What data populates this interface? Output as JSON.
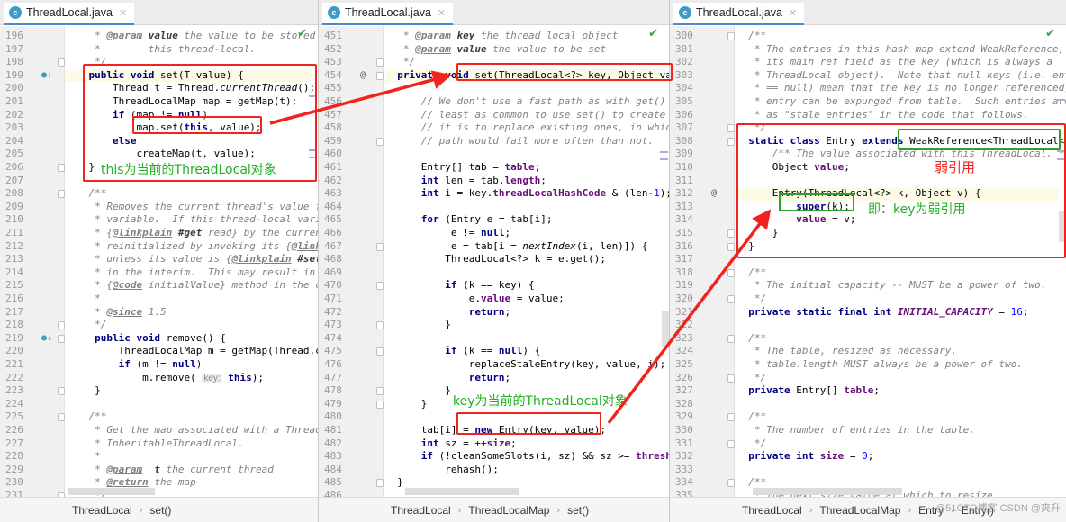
{
  "panes": [
    {
      "tab_label": "ThreadLocal.java",
      "tab_icon": "c",
      "breadcrumb": [
        "ThreadLocal",
        "set()"
      ],
      "lines": [
        {
          "n": "196",
          "html": "     <span class=\"cm\">* </span><span class=\"tag\">@param</span><span class=\"jdb\"> value</span><span class=\"cm\"> the value to be stored</span>"
        },
        {
          "n": "197",
          "html": "     <span class=\"cm\">*        this thread-local.</span>"
        },
        {
          "n": "198",
          "html": "     <span class=\"cm\">*/</span>"
        },
        {
          "n": "199",
          "html": "    <span class=\"kw\">public void</span> set(T value) {",
          "hl": true
        },
        {
          "n": "200",
          "html": "        Thread t = Thread.<span class=\"sit\">currentThread</span>();"
        },
        {
          "n": "201",
          "html": "        ThreadLocalMap map = getMap(t);"
        },
        {
          "n": "202",
          "html": "        <span class=\"kw\">if</span> (map != <span class=\"kw\">null</span>)"
        },
        {
          "n": "203",
          "html": "            map.set(<span class=\"kw\">this</span>, value);"
        },
        {
          "n": "204",
          "html": "        <span class=\"kw\">else</span>"
        },
        {
          "n": "205",
          "html": "            createMap(t, value);"
        },
        {
          "n": "206",
          "html": "    }"
        },
        {
          "n": "207",
          "html": ""
        },
        {
          "n": "208",
          "html": "    <span class=\"cm\">/**</span>"
        },
        {
          "n": "209",
          "html": "     <span class=\"cm\">* Removes the current thread's value for this thread-local</span>"
        },
        {
          "n": "210",
          "html": "     <span class=\"cm\">* variable.  If this thread-local variable is subsequently</span>"
        },
        {
          "n": "211",
          "html": "     <span class=\"cm\">* {</span><span class=\"tag\">@linkplain</span><span class=\"jdb\"> #get</span><span class=\"cm\"> read} by the current thread, its value will be</span>"
        },
        {
          "n": "212",
          "html": "     <span class=\"cm\">* reinitialized by invoking its {</span><span class=\"tag\">@link</span><span class=\"cm\"> #initialValue}</span>"
        },
        {
          "n": "213",
          "html": "     <span class=\"cm\">* unless its value is {</span><span class=\"tag\">@linkplain</span><span class=\"jdb\"> #set</span><span class=\"cm\"> set} by the</span>"
        },
        {
          "n": "214",
          "html": "     <span class=\"cm\">* in the interim.  This may result in multiple</span>"
        },
        {
          "n": "215",
          "html": "     <span class=\"cm\">* {</span><span class=\"tag\">@code</span><span class=\"cm\"> initialValue} method in the current thread.</span>"
        },
        {
          "n": "216",
          "html": "     <span class=\"cm\">*</span>"
        },
        {
          "n": "217",
          "html": "     <span class=\"cm\">* </span><span class=\"tag\">@since</span><span class=\"cm\"> 1.5</span>"
        },
        {
          "n": "218",
          "html": "     <span class=\"cm\">*/</span>"
        },
        {
          "n": "219",
          "html": "     <span class=\"kw\">public void</span> remove() {"
        },
        {
          "n": "220",
          "html": "         ThreadLocalMap m = getMap(Thread.currentThread());"
        },
        {
          "n": "221",
          "html": "         <span class=\"kw\">if</span> (m != <span class=\"kw\">null</span>)"
        },
        {
          "n": "222",
          "html": "             m.remove( <span class=\"hint\">key:</span> <span class=\"kw\">this</span>);"
        },
        {
          "n": "223",
          "html": "     }"
        },
        {
          "n": "224",
          "html": ""
        },
        {
          "n": "225",
          "html": "    <span class=\"cm\">/**</span>"
        },
        {
          "n": "226",
          "html": "     <span class=\"cm\">* Get the map associated with a ThreadLocal. Overridden in</span>"
        },
        {
          "n": "227",
          "html": "     <span class=\"cm\">* InheritableThreadLocal.</span>"
        },
        {
          "n": "228",
          "html": "     <span class=\"cm\">*</span>"
        },
        {
          "n": "229",
          "html": "     <span class=\"cm\">* </span><span class=\"tag\">@param</span><span class=\"jdb\">  t</span><span class=\"cm\"> the current thread</span>"
        },
        {
          "n": "230",
          "html": "     <span class=\"cm\">* </span><span class=\"tag\">@return</span><span class=\"cm\"> the map</span>"
        },
        {
          "n": "231",
          "html": "     <span class=\"cm\">*/</span>"
        }
      ],
      "annotation": "this为当前的ThreadLocal对象"
    },
    {
      "tab_label": "ThreadLocal.java",
      "tab_icon": "c",
      "breadcrumb": [
        "ThreadLocal",
        "ThreadLocalMap",
        "set()"
      ],
      "lines": [
        {
          "n": "451",
          "html": "   <span class=\"cm\">* </span><span class=\"tag\">@param</span><span class=\"jdb\"> key</span><span class=\"cm\"> the thread local object</span>"
        },
        {
          "n": "452",
          "html": "   <span class=\"cm\">* </span><span class=\"tag\">@param</span><span class=\"jdb\"> value</span><span class=\"cm\"> the value to be set</span>"
        },
        {
          "n": "453",
          "html": "   <span class=\"cm\">*/</span>"
        },
        {
          "n": "454",
          "html": "  <span class=\"kw\">private void</span> set(ThreadLocal&lt;?&gt; key, Object value) {",
          "hl": true
        },
        {
          "n": "455",
          "html": ""
        },
        {
          "n": "456",
          "html": "      <span class=\"cm\">// We don't use a fast path as with get() because it is at</span>"
        },
        {
          "n": "457",
          "html": "      <span class=\"cm\">// least as common to use set() to create new entries as</span>"
        },
        {
          "n": "458",
          "html": "      <span class=\"cm\">// it is to replace existing ones, in which case, a fast</span>"
        },
        {
          "n": "459",
          "html": "      <span class=\"cm\">// path would fail more often than not.</span>"
        },
        {
          "n": "460",
          "html": ""
        },
        {
          "n": "461",
          "html": "      Entry[] tab = <span class=\"fld\">table</span>;"
        },
        {
          "n": "462",
          "html": "      <span class=\"kw\">int</span> len = tab.<span class=\"fld\">length</span>;"
        },
        {
          "n": "463",
          "html": "      <span class=\"kw\">int</span> i = key.<span class=\"fld\">threadLocalHashCode</span> &amp; (len-<span class=\"num\">1</span>);"
        },
        {
          "n": "464",
          "html": ""
        },
        {
          "n": "465",
          "html": "      <span class=\"kw\">for</span> (Entry e = tab[i];"
        },
        {
          "n": "466",
          "html": "           e != <span class=\"kw\">null</span>;"
        },
        {
          "n": "467",
          "html": "           e = tab[i = <span class=\"sit\">nextIndex</span>(i, len)]) {"
        },
        {
          "n": "468",
          "html": "          ThreadLocal&lt;?&gt; k = e.get();"
        },
        {
          "n": "469",
          "html": ""
        },
        {
          "n": "470",
          "html": "          <span class=\"kw\">if</span> (k == key) {"
        },
        {
          "n": "471",
          "html": "              e.<span class=\"fld\">value</span> = value;"
        },
        {
          "n": "472",
          "html": "              <span class=\"kw\">return</span>;"
        },
        {
          "n": "473",
          "html": "          }"
        },
        {
          "n": "474",
          "html": ""
        },
        {
          "n": "475",
          "html": "          <span class=\"kw\">if</span> (k == <span class=\"kw\">null</span>) {"
        },
        {
          "n": "476",
          "html": "              replaceStaleEntry(key, value, i);"
        },
        {
          "n": "477",
          "html": "              <span class=\"kw\">return</span>;"
        },
        {
          "n": "478",
          "html": "          }"
        },
        {
          "n": "479",
          "html": "      }"
        },
        {
          "n": "480",
          "html": ""
        },
        {
          "n": "481",
          "html": "      tab[i] = <span class=\"kw\">new</span> Entry(key, value);"
        },
        {
          "n": "482",
          "html": "      <span class=\"kw\">int</span> sz = ++<span class=\"fld\">size</span>;"
        },
        {
          "n": "483",
          "html": "      <span class=\"kw\">if</span> (!cleanSomeSlots(i, sz) &amp;&amp; sz &gt;= <span class=\"fld\">threshold</span>)"
        },
        {
          "n": "484",
          "html": "          rehash();"
        },
        {
          "n": "485",
          "html": "  }"
        },
        {
          "n": "486",
          "html": ""
        }
      ],
      "annotation": "key为当前的ThreadLocal对象"
    },
    {
      "tab_label": "ThreadLocal.java",
      "tab_icon": "c",
      "breadcrumb": [
        "ThreadLocal",
        "ThreadLocalMap",
        "Entry",
        "Entry()"
      ],
      "lines": [
        {
          "n": "300",
          "html": "  <span class=\"cm\">/**</span>"
        },
        {
          "n": "301",
          "html": "   <span class=\"cm\">* The entries in this hash map extend WeakReference, using</span>"
        },
        {
          "n": "302",
          "html": "   <span class=\"cm\">* its main ref field as the key (which is always a</span>"
        },
        {
          "n": "303",
          "html": "   <span class=\"cm\">* ThreadLocal object).  Note that null keys (i.e. entry.get()</span>"
        },
        {
          "n": "304",
          "html": "   <span class=\"cm\">* == null) mean that the key is no longer referenced, so the</span>"
        },
        {
          "n": "305",
          "html": "   <span class=\"cm\">* entry can be expunged from table.  Such entries are referred to</span>"
        },
        {
          "n": "306",
          "html": "   <span class=\"cm\">* as \"stale entries\" in the code that follows.</span>"
        },
        {
          "n": "307",
          "html": "   <span class=\"cm\">*/</span>"
        },
        {
          "n": "308",
          "html": "  <span class=\"kw\">static class</span> Entry <span class=\"kw\">extends</span> WeakReference&lt;ThreadLocal&lt;?&gt;&gt; {"
        },
        {
          "n": "309",
          "html": "      <span class=\"cm\">/** The value associated with this ThreadLocal. */</span>"
        },
        {
          "n": "310",
          "html": "      Object <span class=\"fld\">value</span>;"
        },
        {
          "n": "311",
          "html": ""
        },
        {
          "n": "312",
          "html": "      Entry(ThreadLocal&lt;?&gt; k, Object v) {",
          "hl": true
        },
        {
          "n": "313",
          "html": "          <span class=\"kw\">super</span>(k);"
        },
        {
          "n": "314",
          "html": "          <span class=\"fld\">value</span> = v;"
        },
        {
          "n": "315",
          "html": "      }"
        },
        {
          "n": "316",
          "html": "  }"
        },
        {
          "n": "317",
          "html": ""
        },
        {
          "n": "318",
          "html": "  <span class=\"cm\">/**</span>"
        },
        {
          "n": "319",
          "html": "   <span class=\"cm\">* The initial capacity -- MUST be a power of two.</span>"
        },
        {
          "n": "320",
          "html": "   <span class=\"cm\">*/</span>"
        },
        {
          "n": "321",
          "html": "  <span class=\"kw\">private static final int</span> <span class=\"cst\">INITIAL_CAPACITY</span> = <span class=\"num\">16</span>;"
        },
        {
          "n": "322",
          "html": ""
        },
        {
          "n": "323",
          "html": "  <span class=\"cm\">/**</span>"
        },
        {
          "n": "324",
          "html": "   <span class=\"cm\">* The table, resized as necessary.</span>"
        },
        {
          "n": "325",
          "html": "   <span class=\"cm\">* table.length MUST always be a power of two.</span>"
        },
        {
          "n": "326",
          "html": "   <span class=\"cm\">*/</span>"
        },
        {
          "n": "327",
          "html": "  <span class=\"kw\">private</span> Entry[] <span class=\"fld\">table</span>;"
        },
        {
          "n": "328",
          "html": ""
        },
        {
          "n": "329",
          "html": "  <span class=\"cm\">/**</span>"
        },
        {
          "n": "330",
          "html": "   <span class=\"cm\">* The number of entries in the table.</span>"
        },
        {
          "n": "331",
          "html": "   <span class=\"cm\">*/</span>"
        },
        {
          "n": "332",
          "html": "  <span class=\"kw\">private int</span> <span class=\"fld\">size</span> = <span class=\"num\">0</span>;"
        },
        {
          "n": "333",
          "html": ""
        },
        {
          "n": "334",
          "html": "  <span class=\"cm\">/**</span>"
        },
        {
          "n": "335",
          "html": "   <span class=\"cm\">* The next size value at which to resize.</span>"
        }
      ],
      "annotations": {
        "weak_ref": "弱引用",
        "key_weak": "即：key为弱引用"
      }
    }
  ],
  "watermark": "@51CTO博客  CSDN @爽升",
  "colors": {
    "annotation_red": "#f0241c",
    "annotation_green": "#2ca02c",
    "tab_underline": "#4a88c7"
  }
}
